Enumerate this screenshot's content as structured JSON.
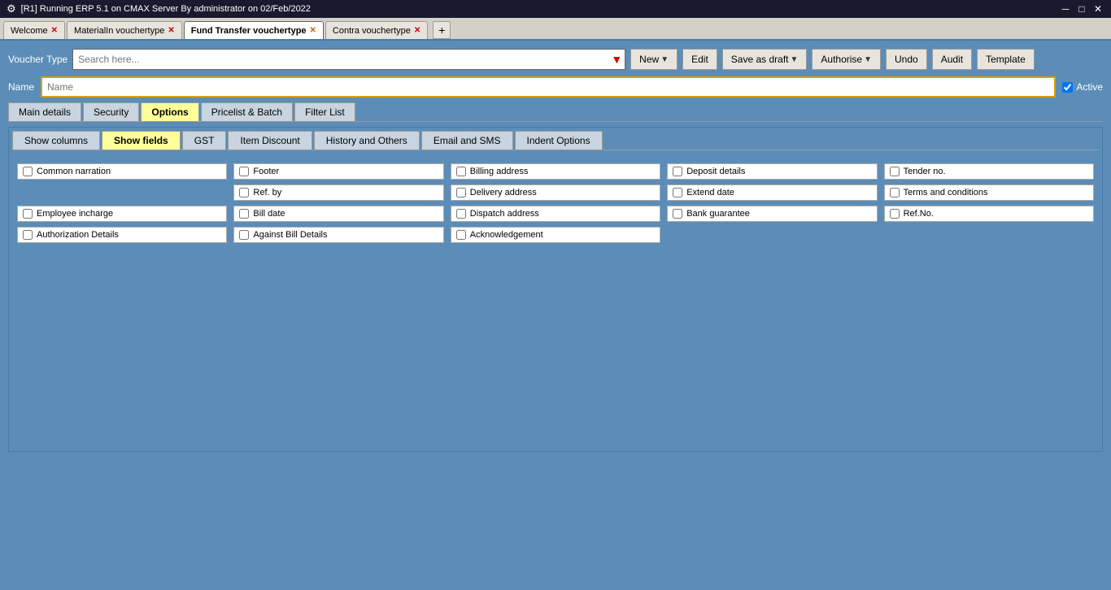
{
  "titlebar": {
    "title": "[R1] Running ERP 5.1 on CMAX Server By administrator on 02/Feb/2022",
    "icon": "★"
  },
  "tabs": [
    {
      "id": "tab-welcome",
      "label": "Welcome",
      "closeable": true,
      "active": false
    },
    {
      "id": "tab-materialin",
      "label": "MaterialIn vouchertype",
      "closeable": true,
      "active": false
    },
    {
      "id": "tab-fundtransfer",
      "label": "Fund Transfer vouchertype",
      "closeable": true,
      "active": true,
      "closeColor": "orange"
    },
    {
      "id": "tab-contra",
      "label": "Contra vouchertype",
      "closeable": true,
      "active": false
    }
  ],
  "toolbar": {
    "voucher_type_label": "Voucher Type",
    "search_placeholder": "Search here...",
    "btn_new": "New",
    "btn_edit": "Edit",
    "btn_save_draft": "Save as draft",
    "btn_authorise": "Authorise",
    "btn_undo": "Undo",
    "btn_audit": "Audit",
    "btn_template": "Template"
  },
  "name_row": {
    "label": "Name",
    "placeholder": "Name",
    "active_label": "Active"
  },
  "nav_tabs": [
    {
      "id": "nav-main",
      "label": "Main details",
      "active": false
    },
    {
      "id": "nav-security",
      "label": "Security",
      "active": false
    },
    {
      "id": "nav-options",
      "label": "Options",
      "active": true
    },
    {
      "id": "nav-pricelist",
      "label": "Pricelist & Batch",
      "active": false
    },
    {
      "id": "nav-filterlist",
      "label": "Filter List",
      "active": false
    }
  ],
  "sub_tabs": [
    {
      "id": "sub-showcols",
      "label": "Show columns",
      "active": false
    },
    {
      "id": "sub-showfields",
      "label": "Show fields",
      "active": true
    },
    {
      "id": "sub-gst",
      "label": "GST",
      "active": false
    },
    {
      "id": "sub-itemdiscount",
      "label": "Item Discount",
      "active": false
    },
    {
      "id": "sub-history",
      "label": "History and Others",
      "active": false
    },
    {
      "id": "sub-emailsms",
      "label": "Email and SMS",
      "active": false
    },
    {
      "id": "sub-indent",
      "label": "Indent Options",
      "active": false
    }
  ],
  "checkboxes": [
    [
      {
        "id": "chk-common-narration",
        "label": "Common narration",
        "checked": false
      },
      {
        "id": "chk-footer",
        "label": "Footer",
        "checked": false
      },
      {
        "id": "chk-billing-address",
        "label": "Billing address",
        "checked": false
      },
      {
        "id": "chk-deposit-details",
        "label": "Deposit details",
        "checked": false
      },
      {
        "id": "chk-tender-no",
        "label": "Tender no.",
        "checked": false
      }
    ],
    [
      {
        "id": "chk-empty1",
        "label": "",
        "empty": true
      },
      {
        "id": "chk-ref-by",
        "label": "Ref. by",
        "checked": false
      },
      {
        "id": "chk-delivery-address",
        "label": "Delivery address",
        "checked": false
      },
      {
        "id": "chk-extend-date",
        "label": "Extend date",
        "checked": false
      },
      {
        "id": "chk-terms",
        "label": "Terms and conditions",
        "checked": false
      }
    ],
    [
      {
        "id": "chk-employee-incharge",
        "label": "Employee incharge",
        "checked": false
      },
      {
        "id": "chk-bill-date",
        "label": "Bill date",
        "checked": false
      },
      {
        "id": "chk-dispatch-address",
        "label": "Dispatch address",
        "checked": false
      },
      {
        "id": "chk-bank-guarantee",
        "label": "Bank guarantee",
        "checked": false
      },
      {
        "id": "chk-ref-no",
        "label": "Ref.No.",
        "checked": false
      }
    ],
    [
      {
        "id": "chk-auth-details",
        "label": "Authorization Details",
        "checked": false
      },
      {
        "id": "chk-against-bill",
        "label": "Against Bill Details",
        "checked": false
      },
      {
        "id": "chk-acknowledgement",
        "label": "Acknowledgement",
        "checked": false
      },
      {
        "id": "chk-empty2",
        "label": "",
        "empty": true
      },
      {
        "id": "chk-empty3",
        "label": "",
        "empty": true
      }
    ]
  ]
}
